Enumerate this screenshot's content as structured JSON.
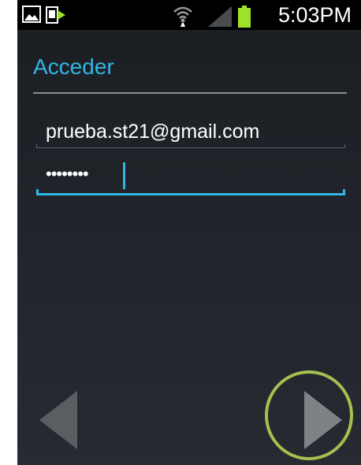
{
  "status_bar": {
    "time": "5:03PM",
    "icons": [
      "gallery-notification-icon",
      "sync-notification-icon",
      "wifi-icon",
      "signal-icon",
      "battery-icon"
    ],
    "battery_color": "#9fe22a"
  },
  "screen": {
    "title": "Acceder",
    "accent_color": "#33b5e5"
  },
  "form": {
    "email": {
      "value": "prueba.st21@gmail.com"
    },
    "password": {
      "masked_value": "••••••••",
      "focused": true
    }
  },
  "navigation": {
    "back_icon": "triangle-left-icon",
    "next_icon": "triangle-right-icon",
    "highlight_color": "#a3c051"
  }
}
